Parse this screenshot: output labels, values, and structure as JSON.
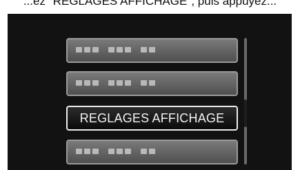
{
  "caption": {
    "text": "...ez \"REGLAGES AFFICHAGE\", puis appuyez..."
  },
  "menu": {
    "items": [
      {
        "label": "",
        "state": "dimmed"
      },
      {
        "label": "",
        "state": "dimmed"
      },
      {
        "label": "REGLAGES AFFICHAGE",
        "state": "selected"
      },
      {
        "label": "",
        "state": "dimmed"
      }
    ]
  },
  "scrollbar": {
    "position_fraction": 0.62,
    "thumb_fraction": 0.22
  },
  "colors": {
    "screen_background": "#121212",
    "selected_item_border": "#eeeeee",
    "dimmed_item_fill": "#6a6a6a"
  }
}
